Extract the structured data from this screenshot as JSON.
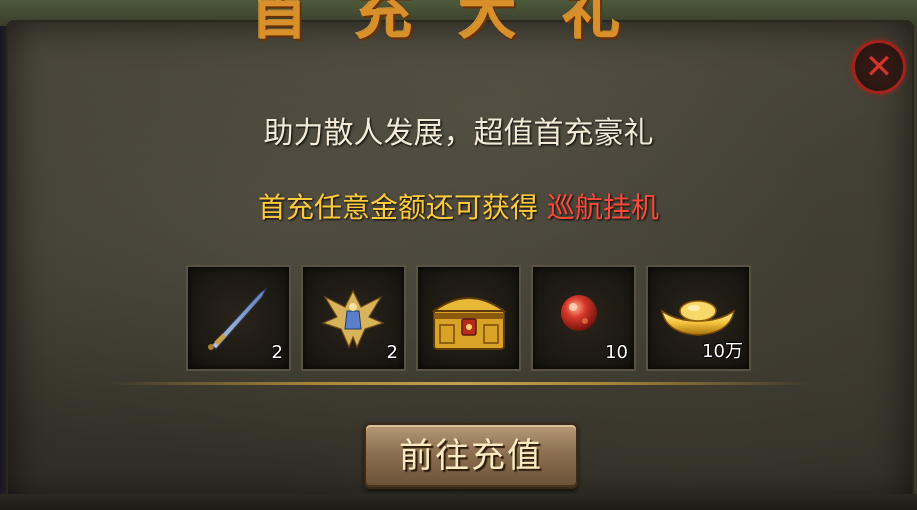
{
  "title": "首充大礼",
  "subtitle": "助力散人发展，超值首充豪礼",
  "promo": {
    "prefix": "首充任意金额还可获得",
    "highlight": "巡航挂机"
  },
  "colors": {
    "title": "#d9902a",
    "promo": "#ffca3c",
    "highlight": "#ff4a3a",
    "close": "#a4221b"
  },
  "rewards": [
    {
      "icon": "sword-icon",
      "qty": "2"
    },
    {
      "icon": "winged-armor-icon",
      "qty": "2"
    },
    {
      "icon": "treasure-chest-icon",
      "qty": ""
    },
    {
      "icon": "red-gem-icon",
      "qty": "10"
    },
    {
      "icon": "gold-ingot-icon",
      "qty": "10万"
    }
  ],
  "button": {
    "label": "前往充值"
  },
  "close_icon": "close-icon"
}
